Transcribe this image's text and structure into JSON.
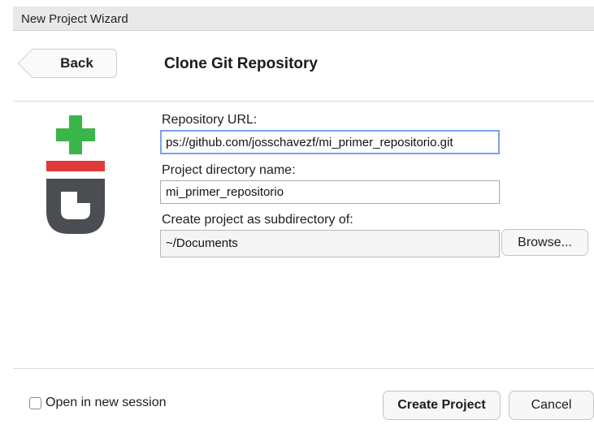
{
  "window": {
    "title": "New Project Wizard"
  },
  "nav": {
    "back_label": "Back"
  },
  "page": {
    "title": "Clone Git Repository"
  },
  "logo": {
    "icon": "git-logo-icon",
    "colors": {
      "plus": "#3ab54a",
      "bar": "#e03b3b",
      "g": "#4a4d52"
    }
  },
  "form": {
    "repo_url": {
      "label": "Repository URL:",
      "value": "ps://github.com/josschavezf/mi_primer_repositorio.git"
    },
    "dir_name": {
      "label": "Project directory name:",
      "value": "mi_primer_repositorio"
    },
    "subdir": {
      "label": "Create project as subdirectory of:",
      "value": "~/Documents",
      "browse_label": "Browse..."
    }
  },
  "footer": {
    "open_new_session_label": "Open in new session",
    "open_new_session_checked": false,
    "create_label": "Create Project",
    "cancel_label": "Cancel"
  }
}
